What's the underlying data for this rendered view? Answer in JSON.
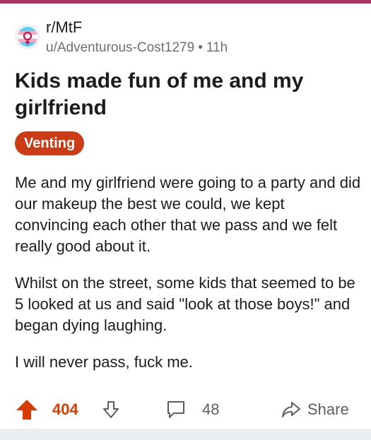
{
  "post": {
    "subreddit": "r/MtF",
    "author": "u/Adventurous-Cost1279",
    "separator": "•",
    "age": "11h",
    "title": "Kids made fun of me and my girlfriend",
    "flair": "Venting",
    "body": [
      "Me and my girlfriend were going to a party and did our makeup the best we could, we kept convincing each other that we pass and we felt really good about it.",
      "Whilst on the street, some kids that seemed to be 5 looked at us and said \"look at those boys!\" and began dying laughing.",
      "I will never pass, fuck me."
    ]
  },
  "actions": {
    "score": "404",
    "comments": "48",
    "share_label": "Share"
  },
  "icons": {
    "avatar": "transgender-symbol-icon",
    "upvote": "upvote-arrow-icon",
    "downvote": "downvote-arrow-icon",
    "comments": "comment-bubble-icon",
    "share": "share-arrow-icon"
  },
  "colors": {
    "accent": "#d93a00",
    "flair_bg": "#cc3d17",
    "top_bar": "#a8325f",
    "muted_text": "#6b6f73"
  }
}
